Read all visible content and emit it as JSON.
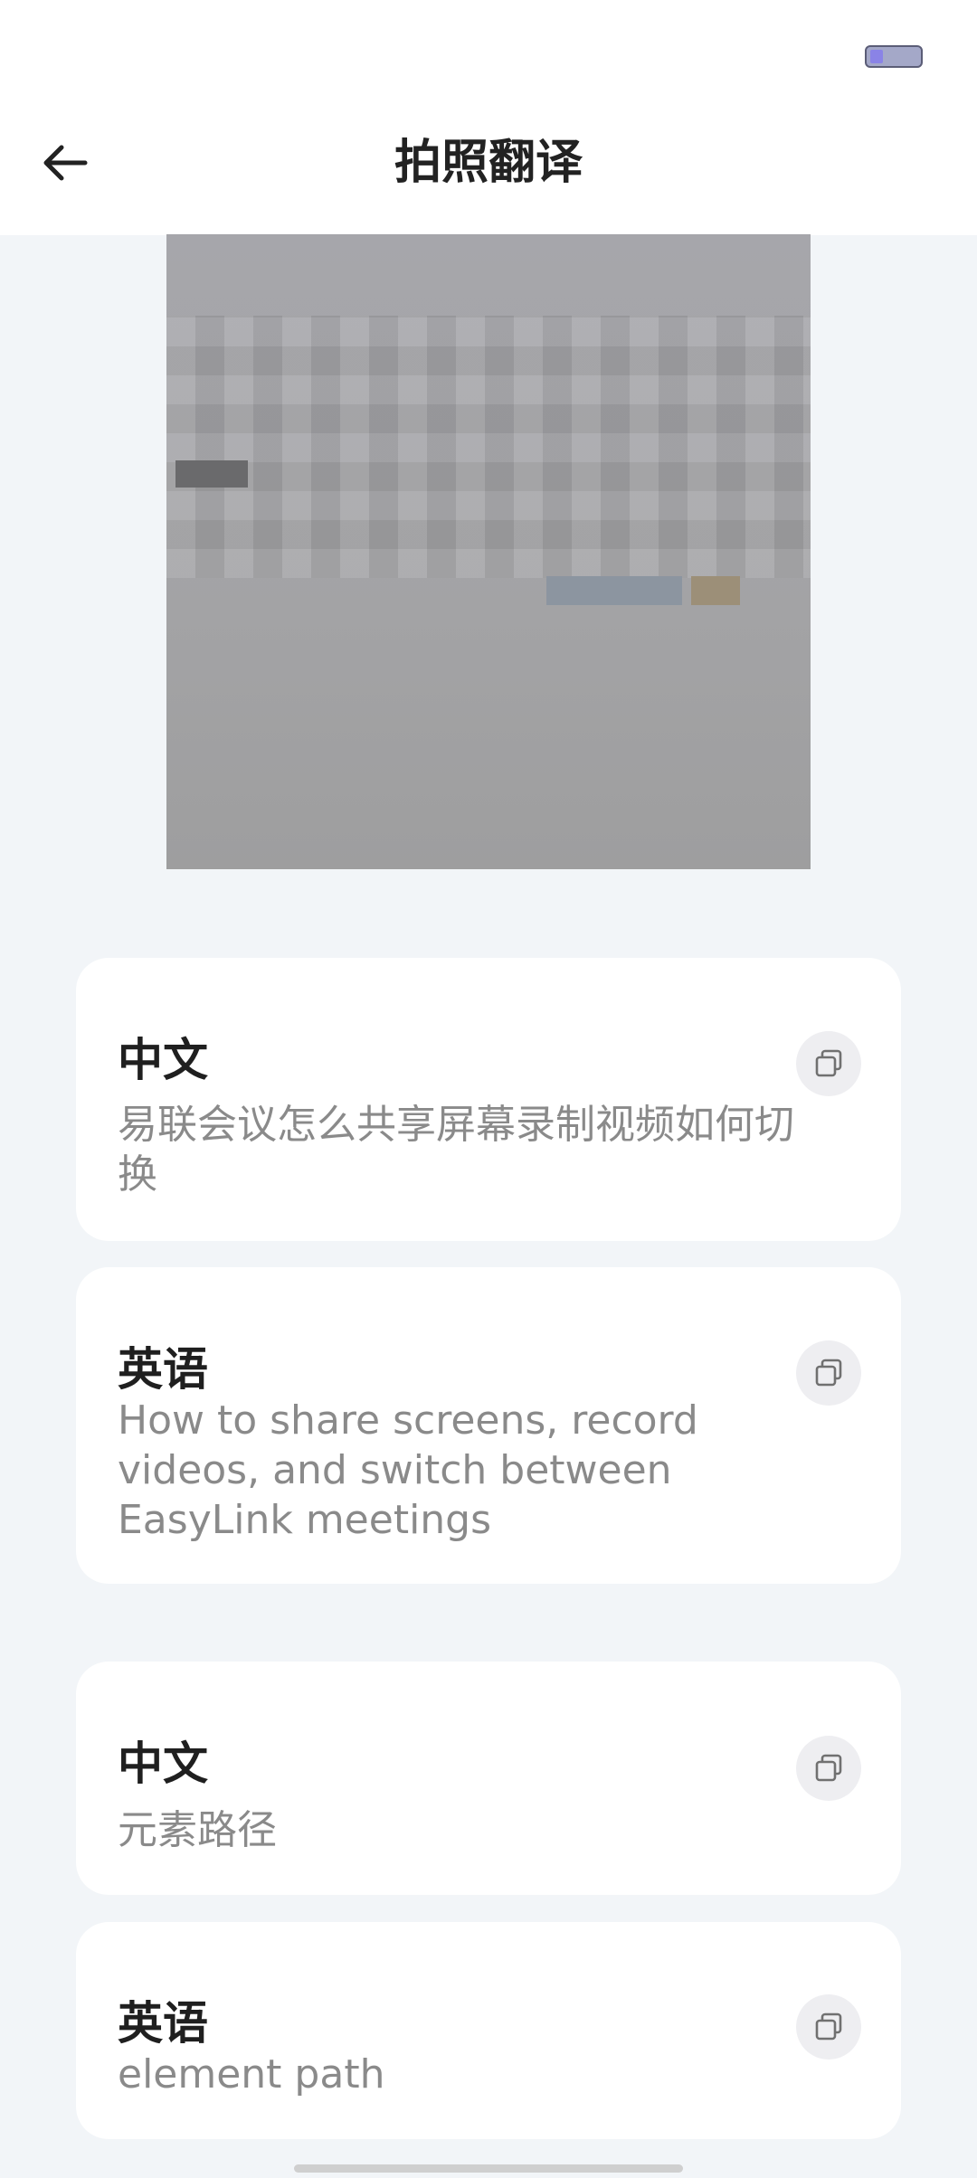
{
  "header": {
    "title": "拍照翻译",
    "back_icon": "arrow-left-icon"
  },
  "status_bar": {
    "battery_icon": "battery-icon"
  },
  "results": [
    {
      "source_lang": "中文",
      "source_text": "易联会议怎么共享屏幕录制视频如何切换",
      "target_lang": "英语",
      "target_text": "How to share screens, record videos, and switch between EasyLink meetings"
    },
    {
      "source_lang": "中文",
      "source_text": "元素路径",
      "target_lang": "英语",
      "target_text": "element path"
    }
  ],
  "copy_icon": "copy-icon",
  "colors": {
    "background": "#f2f5f8",
    "card": "#ffffff",
    "title": "#222222",
    "secondary_text": "#8a8a8a"
  }
}
